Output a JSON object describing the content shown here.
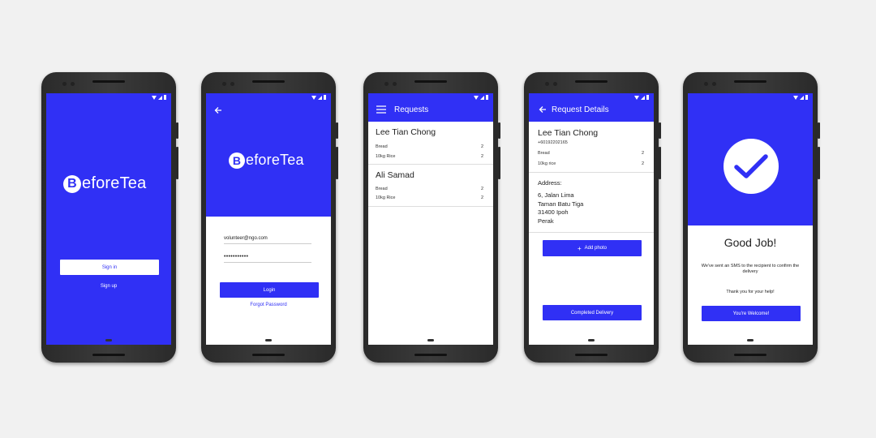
{
  "colors": {
    "primary": "#3030f5",
    "background": "#f1f1f1",
    "white": "#ffffff"
  },
  "screen1": {
    "logo_initial": "B",
    "logo_text": "eforeTea",
    "signin_label": "Sign in",
    "signup_label": "Sign up"
  },
  "screen2": {
    "logo_initial": "B",
    "logo_text": "eforeTea",
    "email_value": "volunteer@ngo.com",
    "password_value": "•••••••••••",
    "login_label": "Login",
    "forgot_label": "Forgot Password"
  },
  "screen3": {
    "title": "Requests",
    "requests": [
      {
        "name": "Lee Tian Chong",
        "items": [
          {
            "item": "Bread",
            "qty": "2"
          },
          {
            "item": "10kg Rice",
            "qty": "2"
          }
        ]
      },
      {
        "name": "Ali Samad",
        "items": [
          {
            "item": "Bread",
            "qty": "2"
          },
          {
            "item": "10kg Rice",
            "qty": "2"
          }
        ]
      }
    ]
  },
  "screen4": {
    "title": "Request Details",
    "name": "Lee Tian Chong",
    "phone": "+60192202165",
    "items": [
      {
        "item": "Bread",
        "qty": "2"
      },
      {
        "item": "10kg rice",
        "qty": "2"
      }
    ],
    "address_label": "Address:",
    "address_lines": [
      "6, Jalan Lima",
      "Taman Batu Tiga",
      "31400 Ipoh",
      "Perak"
    ],
    "add_photo_label": "Add photo",
    "complete_label": "Completed Delivery"
  },
  "screen5": {
    "heading": "Good Job!",
    "message": "We've sent an SMS to the recipient to confirm the delivery",
    "thanks": "Thank you for your help!",
    "button_label": "You're Welcome!"
  }
}
